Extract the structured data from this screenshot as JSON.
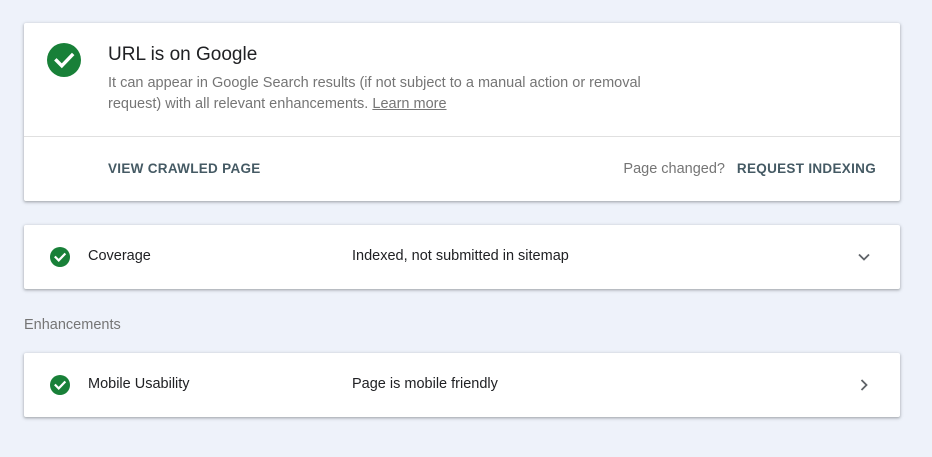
{
  "status": {
    "title": "URL is on Google",
    "description": "It can appear in Google Search results (if not subject to a manual action or removal request) with all relevant enhancements.",
    "learn_more": "Learn more",
    "view_crawled_label": "VIEW CRAWLED PAGE",
    "page_changed_label": "Page changed?",
    "request_indexing_label": "REQUEST INDEXING",
    "icon": "check-circle-icon"
  },
  "coverage": {
    "label": "Coverage",
    "value": "Indexed, not submitted in sitemap",
    "icon": "check-circle-icon",
    "action_icon": "chevron-down-icon"
  },
  "enhancements": {
    "section_label": "Enhancements",
    "items": [
      {
        "label": "Mobile Usability",
        "value": "Page is mobile friendly",
        "icon": "check-circle-icon",
        "action_icon": "chevron-right-icon"
      }
    ]
  },
  "colors": {
    "success": "#188038",
    "background": "#eef2fa",
    "card": "#ffffff",
    "action_text": "#455a64",
    "secondary_text": "#757575"
  }
}
